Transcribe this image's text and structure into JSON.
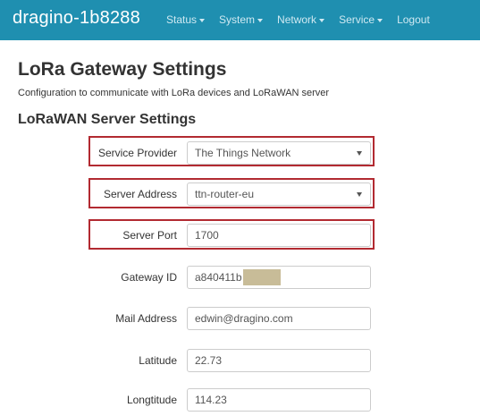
{
  "navbar": {
    "brand": "dragino-1b8288",
    "menu": [
      {
        "label": "Status",
        "has_dropdown": true
      },
      {
        "label": "System",
        "has_dropdown": true
      },
      {
        "label": "Network",
        "has_dropdown": true
      },
      {
        "label": "Service",
        "has_dropdown": true
      },
      {
        "label": "Logout",
        "has_dropdown": false
      }
    ],
    "color": "#1f8fb0"
  },
  "page": {
    "title": "LoRa Gateway Settings",
    "subtitle": "Configuration to communicate with LoRa devices and LoRaWAN server"
  },
  "section": {
    "title": "LoRaWAN Server Settings"
  },
  "form": {
    "service_provider": {
      "label": "Service Provider",
      "value": "The Things Network",
      "highlighted": true
    },
    "server_address": {
      "label": "Server Address",
      "value": "ttn-router-eu",
      "highlighted": true
    },
    "server_port": {
      "label": "Server Port",
      "value": "1700",
      "highlighted": true
    },
    "gateway_id": {
      "label": "Gateway ID",
      "value": "a840411b",
      "redacted_suffix": true
    },
    "mail_address": {
      "label": "Mail Address",
      "value": "edwin@dragino.com"
    },
    "latitude": {
      "label": "Latitude",
      "value": "22.73"
    },
    "longitude": {
      "label": "Longtitude",
      "value": "114.23"
    }
  },
  "colors": {
    "highlight_border": "#b22a31",
    "redaction": "#c8bc98"
  }
}
